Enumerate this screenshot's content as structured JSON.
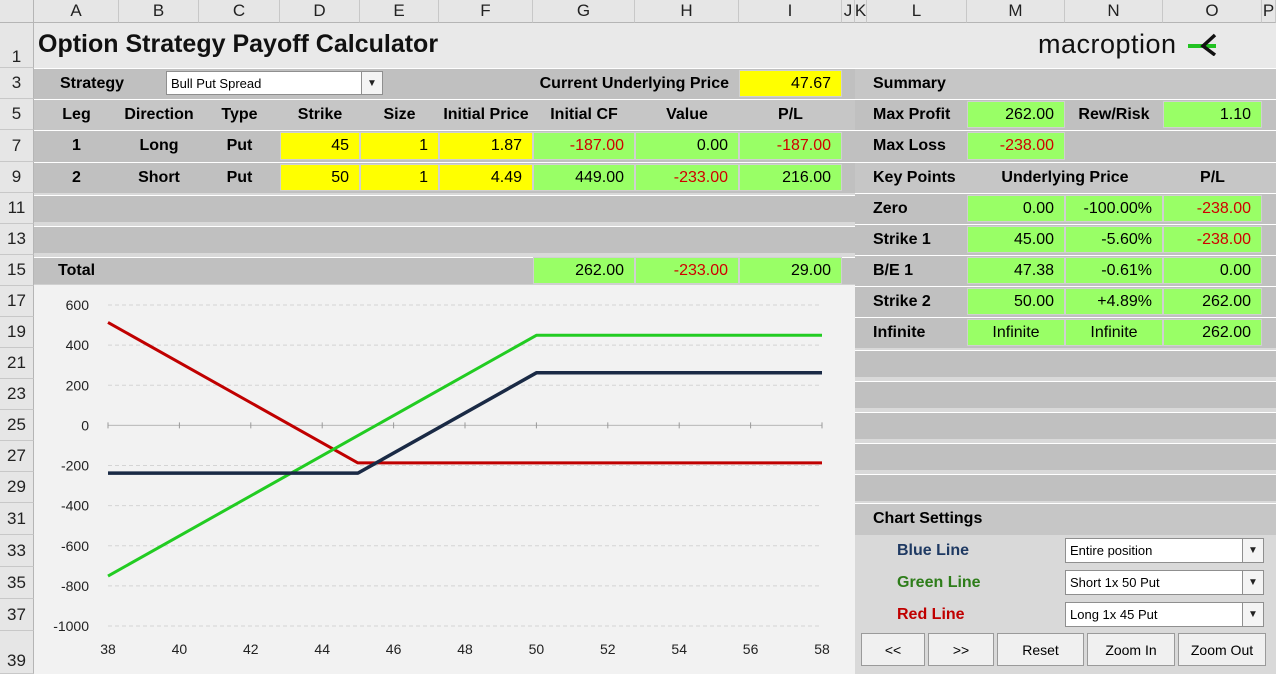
{
  "sheet": {
    "columns": [
      "A",
      "B",
      "C",
      "D",
      "E",
      "F",
      "G",
      "H",
      "I",
      "J",
      "K",
      "L",
      "M",
      "N",
      "O",
      "P"
    ],
    "rows": [
      "1",
      "3",
      "5",
      "7",
      "9",
      "11",
      "13",
      "15",
      "17",
      "19",
      "21",
      "23",
      "25",
      "27",
      "29",
      "31",
      "33",
      "35",
      "37",
      "39"
    ]
  },
  "title": "Option Strategy Payoff Calculator",
  "logo": {
    "text": "macroption",
    "accent": "#22c222"
  },
  "strategy": {
    "label": "Strategy",
    "value": "Bull Put Spread"
  },
  "underlying": {
    "label": "Current Underlying Price",
    "value": "47.67"
  },
  "legs": {
    "headers": [
      "Leg",
      "Direction",
      "Type",
      "Strike",
      "Size",
      "Initial Price",
      "Initial CF",
      "Value",
      "P/L"
    ],
    "rows": [
      [
        "1",
        "Long",
        "Put",
        "45",
        "1",
        "1.87",
        "-187.00",
        "0.00",
        "-187.00"
      ],
      [
        "2",
        "Short",
        "Put",
        "50",
        "1",
        "4.49",
        "449.00",
        "-233.00",
        "216.00"
      ]
    ],
    "total_label": "Total",
    "total": [
      "262.00",
      "-233.00",
      "29.00"
    ]
  },
  "summary": {
    "title": "Summary",
    "max_profit_label": "Max Profit",
    "max_profit": "262.00",
    "rew_risk_label": "Rew/Risk",
    "rew_risk": "1.10",
    "max_loss_label": "Max Loss",
    "max_loss": "-238.00"
  },
  "key_points": {
    "headers": [
      "Key Points",
      "Underlying Price",
      "P/L"
    ],
    "rows": [
      [
        "Zero",
        "0.00",
        "-100.00%",
        "-238.00"
      ],
      [
        "Strike 1",
        "45.00",
        "-5.60%",
        "-238.00"
      ],
      [
        "B/E 1",
        "47.38",
        "-0.61%",
        "0.00"
      ],
      [
        "Strike 2",
        "50.00",
        "+4.89%",
        "262.00"
      ],
      [
        "Infinite",
        "Infinite",
        "Infinite",
        "262.00"
      ]
    ]
  },
  "chart_settings": {
    "title": "Chart Settings",
    "blue_label": "Blue Line",
    "blue_value": "Entire position",
    "green_label": "Green Line",
    "green_value": "Short 1x 50 Put",
    "red_label": "Red Line",
    "red_value": "Long 1x 45 Put"
  },
  "buttons": {
    "prev": "<<",
    "next": ">>",
    "reset": "Reset",
    "zoom_in": "Zoom In",
    "zoom_out": "Zoom Out"
  },
  "colors": {
    "blue": "#1a2a45",
    "green": "#22cc22",
    "red": "#c00000",
    "loss_text": "#d00000"
  },
  "chart_data": {
    "type": "line",
    "x": [
      38,
      45,
      50,
      58
    ],
    "xlim": [
      38,
      58
    ],
    "ylim": [
      -1000,
      600
    ],
    "xticks": [
      "38",
      "40",
      "42",
      "44",
      "46",
      "48",
      "50",
      "52",
      "54",
      "56",
      "58"
    ],
    "yticks": [
      "600",
      "400",
      "200",
      "0",
      "-200",
      "-400",
      "-600",
      "-800",
      "-1000"
    ],
    "grid": true,
    "series": [
      {
        "color": "#1a2a45",
        "values": [
          -238,
          -238,
          262,
          262
        ]
      },
      {
        "color": "#22cc22",
        "values": [
          -751,
          -51,
          449,
          449
        ]
      },
      {
        "color": "#c00000",
        "values": [
          513,
          -187,
          -187,
          -187
        ]
      }
    ]
  }
}
